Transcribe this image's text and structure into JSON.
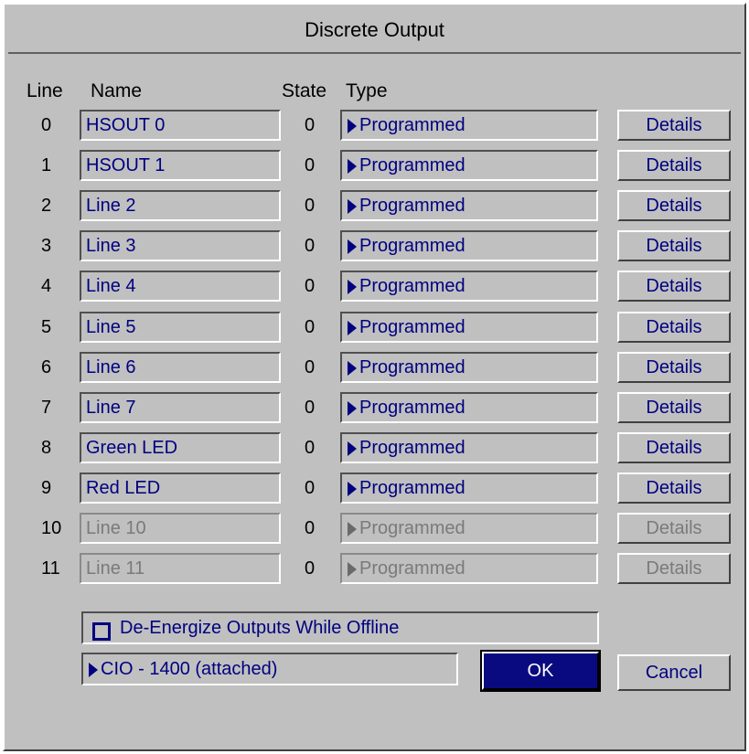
{
  "dialog": {
    "title": "Discrete Output"
  },
  "headers": {
    "line": "Line",
    "name": "Name",
    "state": "State",
    "type": "Type"
  },
  "rows": [
    {
      "line": "0",
      "name": "HSOUT 0",
      "state": "0",
      "type": "Programmed",
      "details": "Details",
      "enabled": true
    },
    {
      "line": "1",
      "name": "HSOUT 1",
      "state": "0",
      "type": "Programmed",
      "details": "Details",
      "enabled": true
    },
    {
      "line": "2",
      "name": "Line 2",
      "state": "0",
      "type": "Programmed",
      "details": "Details",
      "enabled": true
    },
    {
      "line": "3",
      "name": "Line 3",
      "state": "0",
      "type": "Programmed",
      "details": "Details",
      "enabled": true
    },
    {
      "line": "4",
      "name": "Line 4",
      "state": "0",
      "type": "Programmed",
      "details": "Details",
      "enabled": true
    },
    {
      "line": "5",
      "name": "Line 5",
      "state": "0",
      "type": "Programmed",
      "details": "Details",
      "enabled": true
    },
    {
      "line": "6",
      "name": "Line 6",
      "state": "0",
      "type": "Programmed",
      "details": "Details",
      "enabled": true
    },
    {
      "line": "7",
      "name": "Line 7",
      "state": "0",
      "type": "Programmed",
      "details": "Details",
      "enabled": true
    },
    {
      "line": "8",
      "name": "Green LED",
      "state": "0",
      "type": "Programmed",
      "details": "Details",
      "enabled": true
    },
    {
      "line": "9",
      "name": "Red LED",
      "state": "0",
      "type": "Programmed",
      "details": "Details",
      "enabled": true
    },
    {
      "line": "10",
      "name": "Line 10",
      "state": "0",
      "type": "Programmed",
      "details": "Details",
      "enabled": false
    },
    {
      "line": "11",
      "name": "Line 11",
      "state": "0",
      "type": "Programmed",
      "details": "Details",
      "enabled": false
    }
  ],
  "options": {
    "deenergize_label": "De-Energize Outputs While Offline",
    "deenergize_checked": false
  },
  "device": {
    "label": "CIO - 1400 (attached)"
  },
  "buttons": {
    "ok": "OK",
    "cancel": "Cancel"
  },
  "colors": {
    "background": "#c0c0c0",
    "text_enabled": "#000080",
    "text_disabled": "#7a7a7a",
    "ok_button": "#0a0a80"
  }
}
